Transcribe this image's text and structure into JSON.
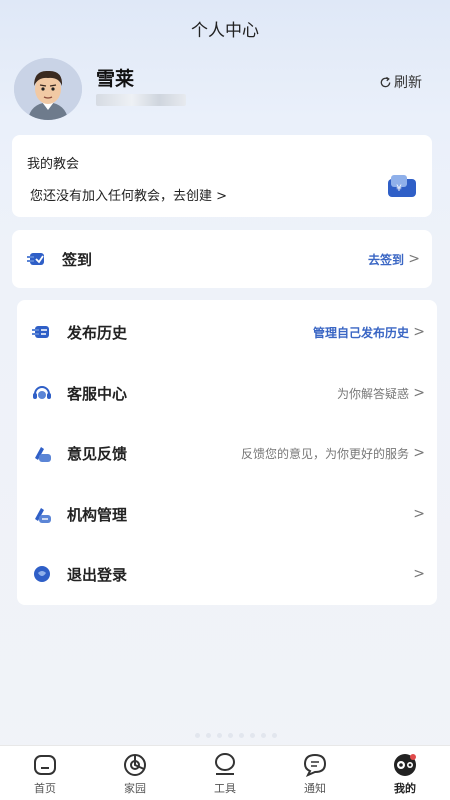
{
  "header": {
    "title": "个人中心"
  },
  "profile": {
    "name": "雪莱",
    "id_masked": "",
    "refresh_label": "刷新"
  },
  "church": {
    "title": "我的教会",
    "prompt": "您还没有加入任何教会，去创建 >"
  },
  "checkin": {
    "label": "签到",
    "hint": "去签到",
    "chevron": ">"
  },
  "menu": {
    "items": [
      {
        "label": "发布历史",
        "hint": "管理自己发布历史",
        "chevron": ">"
      },
      {
        "label": "客服中心",
        "hint": "为你解答疑惑",
        "chevron": ">"
      },
      {
        "label": "意见反馈",
        "hint": "反馈您的意见，为你更好的服务",
        "chevron": ">"
      },
      {
        "label": "机构管理",
        "hint": "",
        "chevron": ">"
      },
      {
        "label": "退出登录",
        "hint": "",
        "chevron": ">"
      }
    ]
  },
  "nav": {
    "items": [
      {
        "label": "首页",
        "icon": "home-icon"
      },
      {
        "label": "家园",
        "icon": "pie-chart-icon"
      },
      {
        "label": "工具",
        "icon": "tools-icon"
      },
      {
        "label": "通知",
        "icon": "chat-bubble-icon"
      },
      {
        "label": "我的",
        "icon": "mascot-icon",
        "active": true
      }
    ]
  },
  "colors": {
    "accent": "#3a66c4",
    "icon_blue": "#2f5fc7",
    "text": "#222222",
    "hint": "#777777"
  }
}
